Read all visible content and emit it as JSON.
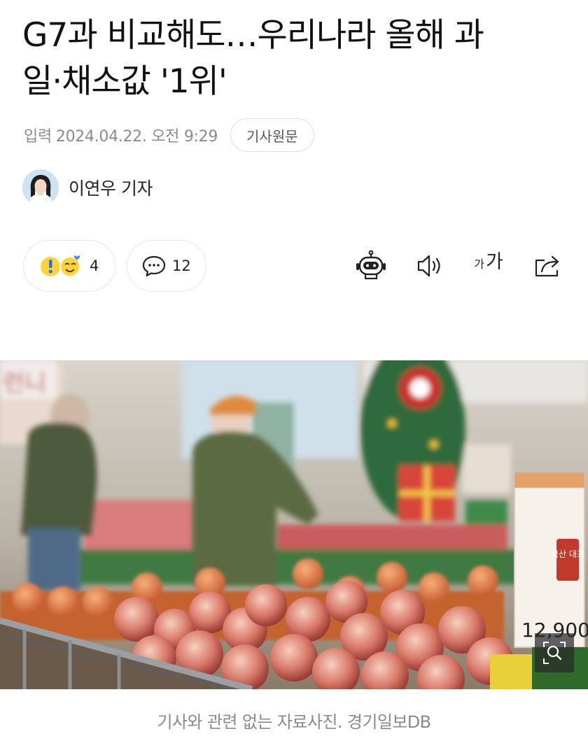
{
  "article": {
    "title_line1": "G7과 비교해도…우리나라 올해 과",
    "title_line2": "일·채소값 '1위'",
    "date_label": "입력",
    "date_value": "2024.04.22. 오전 9:29",
    "source_button": "기사원문",
    "author": "이연우 기자"
  },
  "reactions": {
    "emoji_count": "4",
    "comment_count": "12"
  },
  "toolbar": {
    "icons": [
      "robot-summary-icon",
      "speaker-icon",
      "font-size-icon",
      "share-icon"
    ],
    "font_small": "가",
    "font_large": "가"
  },
  "photo": {
    "price_tag_text": "12,900",
    "sign_text": "국산 대표"
  },
  "caption": "기사와 관련 없는 자료사진. 경기일보DB",
  "colors": {
    "text_primary": "#111111",
    "text_muted": "#8a8a8a",
    "border": "#e6e6e6"
  }
}
